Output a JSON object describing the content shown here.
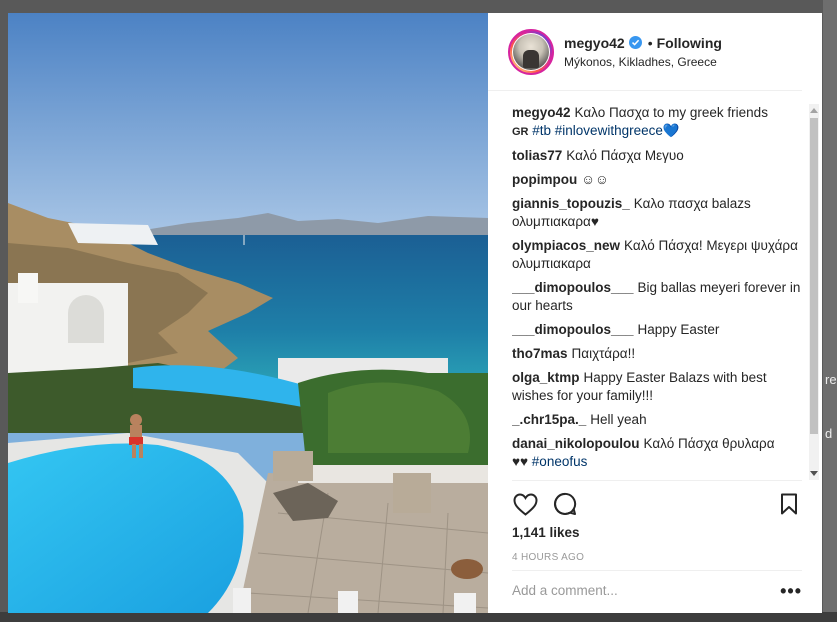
{
  "header": {
    "username": "megyo42",
    "separator": "•",
    "follow_status": "Following",
    "location": "Mýkonos, Kikladhes, Greece"
  },
  "comments": [
    {
      "user": "megyo42",
      "text": "Καλο Πασχα to my greek friends",
      "extra_prefix": "GR",
      "tags": "#tb #inlovewithgreece💙"
    },
    {
      "user": "tolias77",
      "text": "Καλό Πάσχα Μεγυο"
    },
    {
      "user": "popimpou",
      "text": "☺☺"
    },
    {
      "user": "giannis_topouzis_",
      "text": "Καλο πασχα balazs ολυμπιακαρα♥"
    },
    {
      "user": "olympiacos_new",
      "text": "Καλό Πάσχα! Μεγερι ψυχάρα ολυμπιακαρα"
    },
    {
      "user": "___dimopoulos___",
      "text": "Big ballas meyeri forever in our hearts"
    },
    {
      "user": "___dimopoulos___",
      "text": "Happy Easter"
    },
    {
      "user": "tho7mas",
      "text": "Παιχτάρα!!"
    },
    {
      "user": "olga_ktmp",
      "text": "Happy Easter Balazs with best wishes for your family!!!"
    },
    {
      "user": "_.chr15pa._",
      "text": "Hell yeah"
    },
    {
      "user": "danai_nikolopoulou",
      "text": "Καλό Πάσχα θρυλαρα",
      "tail_prefix": "♥♥",
      "tags": "#oneofus"
    }
  ],
  "actions": {
    "likes": "1,141 likes",
    "time_ago": "4 HOURS AGO",
    "icons": [
      "heart-icon",
      "comment-icon",
      "bookmark-icon"
    ]
  },
  "add_comment": {
    "placeholder": "Add a comment...",
    "more_label": "•••"
  },
  "edge": {
    "t1": "re",
    "t2": "d"
  },
  "colors": {
    "verified": "#3897f0",
    "tag": "#003569",
    "sea": "#1c6e9e",
    "pool": "#2bb3ea"
  }
}
